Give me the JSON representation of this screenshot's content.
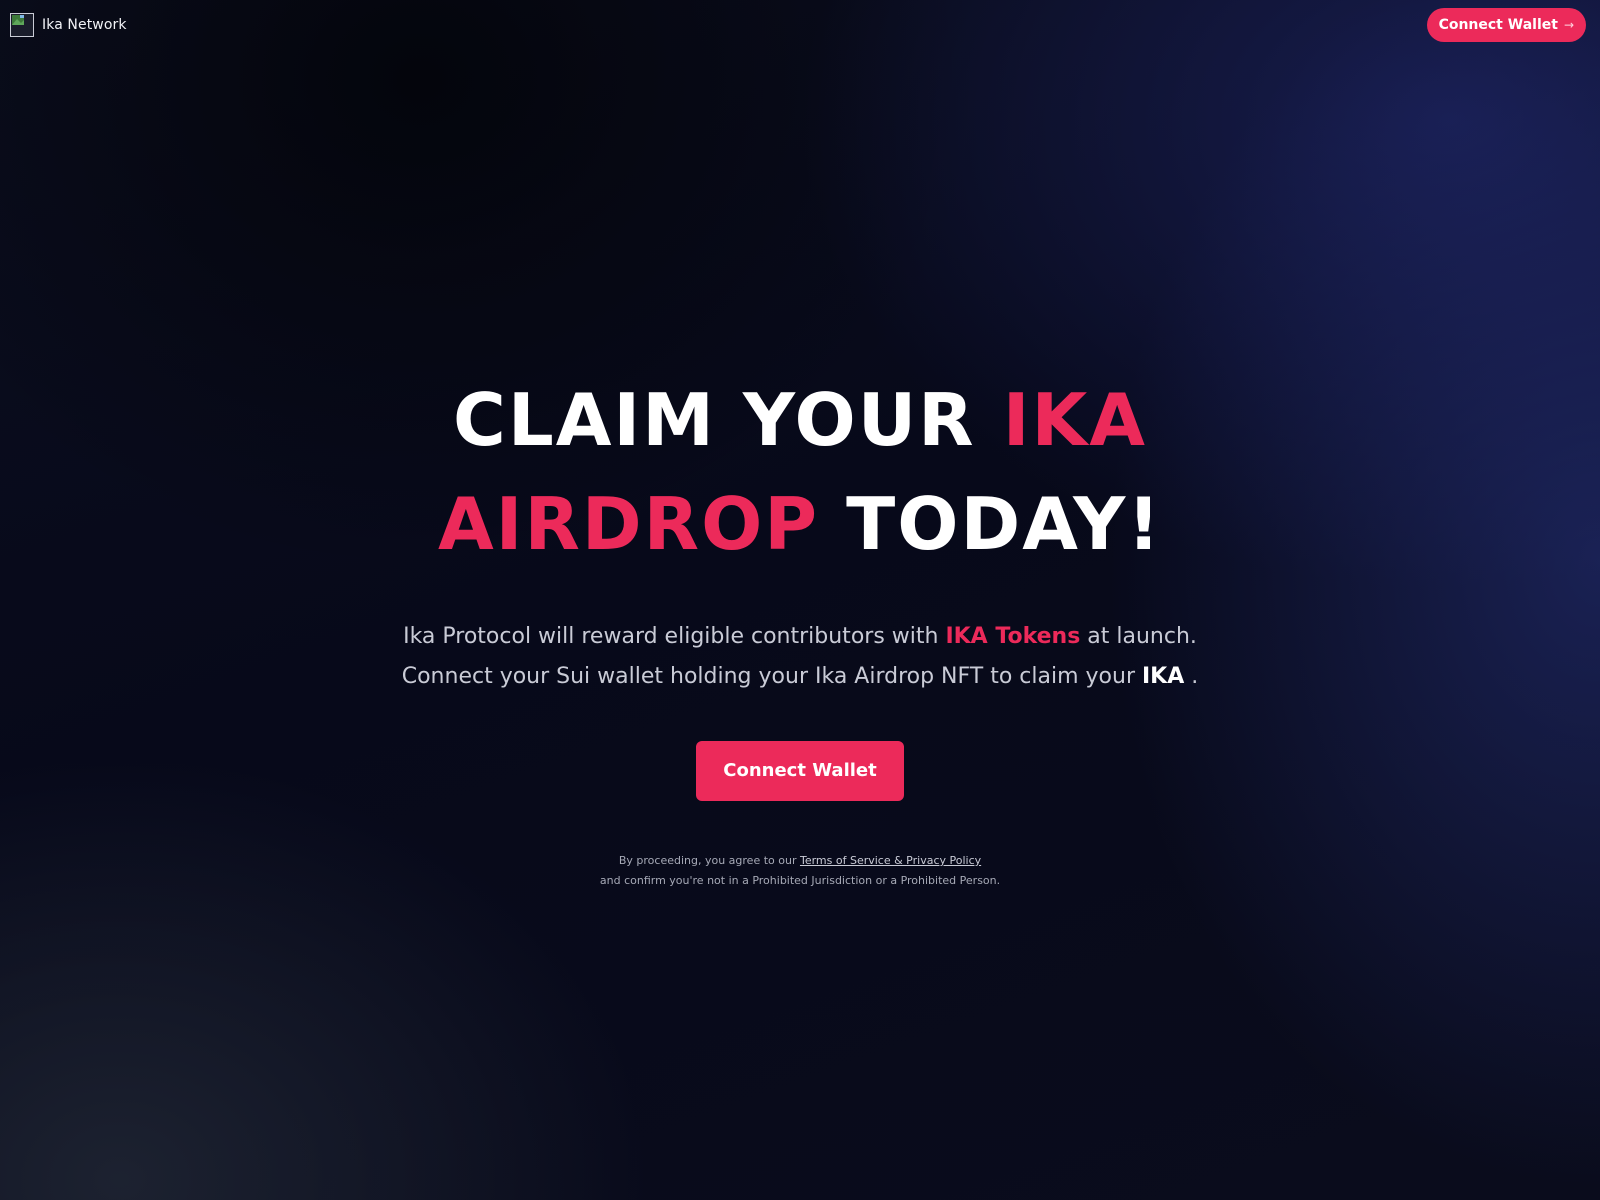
{
  "nav": {
    "brand_name": "Ika Network",
    "connect_label": "Connect Wallet",
    "connect_icon": "arrow-right-icon"
  },
  "hero": {
    "headline": {
      "part1": "CLAIM YOUR ",
      "part2_accent": "IKA",
      "part3_accent": "AIRDROP",
      "part4": " TODAY!"
    },
    "subtitle": {
      "line1_a": "Ika Protocol will reward eligible contributors with ",
      "line1_b_accent": "IKA Tokens",
      "line1_c": " at launch.",
      "line2_a": "Connect your Sui wallet holding your Ika Airdrop NFT to claim your ",
      "line2_b_bold": "IKA",
      "line2_c": " ."
    },
    "cta_label": "Connect Wallet"
  },
  "legal": {
    "line1_prefix": "By proceeding, you agree to our ",
    "terms_link": "Terms of Service & Privacy Policy",
    "line2": "and confirm you're not in a Prohibited Jurisdiction or a Prohibited Person."
  },
  "colors": {
    "accent": "#ec2a5a",
    "background": "#07091a",
    "text": "#ffffff",
    "muted": "#c9cbd6"
  }
}
